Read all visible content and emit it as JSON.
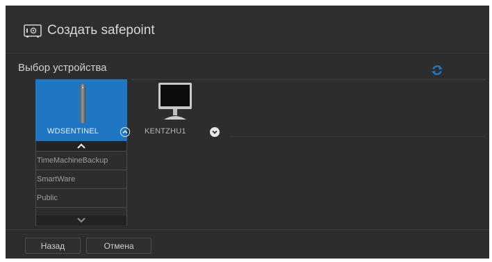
{
  "dialog": {
    "title": "Создать safepoint",
    "header_icon": "safe-icon"
  },
  "section": {
    "title": "Выбор устройства",
    "refresh_icon": "refresh-icon",
    "accent_color": "#1f77c4"
  },
  "devices": [
    {
      "label": "WDSENTINEL",
      "selected": true,
      "icon": "nas-drive-icon",
      "chevron": "chevron-up-circle-icon"
    },
    {
      "label": "KENTZHU1",
      "selected": false,
      "icon": "monitor-icon",
      "chevron": "chevron-down-circle-icon"
    }
  ],
  "shares": [
    "TimeMachineBackup",
    "SmartWare",
    "Public"
  ],
  "footer": {
    "back_label": "Назад",
    "cancel_label": "Отмена"
  }
}
